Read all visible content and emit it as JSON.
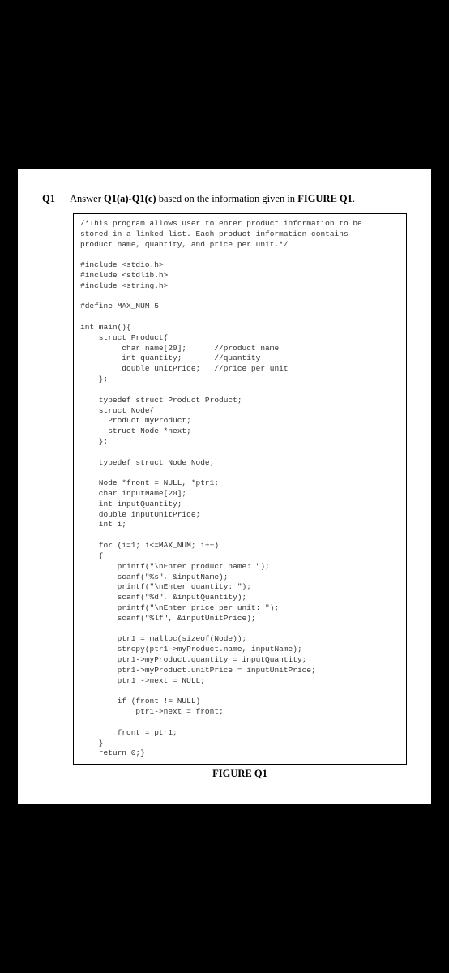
{
  "question": {
    "label": "Q1",
    "prompt_pre": "Answer ",
    "prompt_bold1": "Q1(a)-Q1(c)",
    "prompt_mid": " based on the information given in ",
    "prompt_bold2": "FIGURE Q1",
    "prompt_post": "."
  },
  "code": "/*This program allows user to enter product information to be\nstored in a linked list. Each product information contains\nproduct name, quantity, and price per unit.*/\n\n#include <stdio.h>\n#include <stdlib.h>\n#include <string.h>\n\n#define MAX_NUM 5\n\nint main(){\n    struct Product{\n         char name[20];      //product name\n         int quantity;       //quantity\n         double unitPrice;   //price per unit\n    };\n\n    typedef struct Product Product;\n    struct Node{\n      Product myProduct;\n      struct Node *next;\n    };\n\n    typedef struct Node Node;\n\n    Node *front = NULL, *ptr1;\n    char inputName[20];\n    int inputQuantity;\n    double inputUnitPrice;\n    int i;\n\n    for (i=1; i<=MAX_NUM; i++)\n    {\n        printf(\"\\nEnter product name: \");\n        scanf(\"%s\", &inputName);\n        printf(\"\\nEnter quantity: \");\n        scanf(\"%d\", &inputQuantity);\n        printf(\"\\nEnter price per unit: \");\n        scanf(\"%lf\", &inputUnitPrice);\n\n        ptr1 = malloc(sizeof(Node));\n        strcpy(ptr1->myProduct.name, inputName);\n        ptr1->myProduct.quantity = inputQuantity;\n        ptr1->myProduct.unitPrice = inputUnitPrice;\n        ptr1 ->next = NULL;\n\n        if (front != NULL)\n            ptr1->next = front;\n\n        front = ptr1;\n    }\n    return 0;}",
  "figure_caption": "FIGURE Q1"
}
